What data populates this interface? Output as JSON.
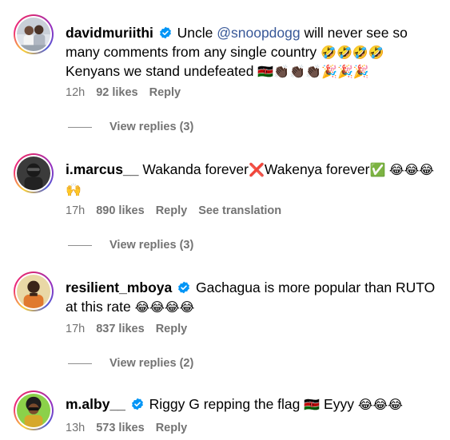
{
  "comments": [
    {
      "username": "davidmuriithi",
      "verified": true,
      "text_parts": [
        "Uncle ",
        "@snoopdogg",
        " will never see so many comments from any single country ",
        "🤣🤣🤣🤣",
        " Kenyans we stand undefeated ",
        "🇰🇪",
        "👏🏿👏🏿👏🏿🎉🎉🎉"
      ],
      "time": "12h",
      "likes": "92 likes",
      "reply": "Reply",
      "view_replies": "View replies (3)"
    },
    {
      "username": "i.marcus__",
      "verified": false,
      "text_parts": [
        "Wakanda forever",
        "❌",
        "Wakenya forever",
        "✅",
        " 😂😂😂 ",
        "🙌"
      ],
      "time": "17h",
      "likes": "890 likes",
      "reply": "Reply",
      "see_translation": "See translation",
      "view_replies": "View replies (3)"
    },
    {
      "username": "resilient_mboya",
      "verified": true,
      "text_parts": [
        "Gachagua is more popular than RUTO at this rate ",
        "😂😂😂😂"
      ],
      "time": "17h",
      "likes": "837 likes",
      "reply": "Reply",
      "view_replies": "View replies (2)"
    },
    {
      "username": "m.alby__",
      "verified": true,
      "text_parts": [
        "Riggy G repping the flag ",
        "🇰🇪",
        " Eyyy ",
        "😂😂😂"
      ],
      "time": "13h",
      "likes": "573 likes",
      "reply": "Reply"
    }
  ],
  "colors": {
    "verified": "#0095f6",
    "mention": "#385898",
    "meta": "#737373"
  }
}
